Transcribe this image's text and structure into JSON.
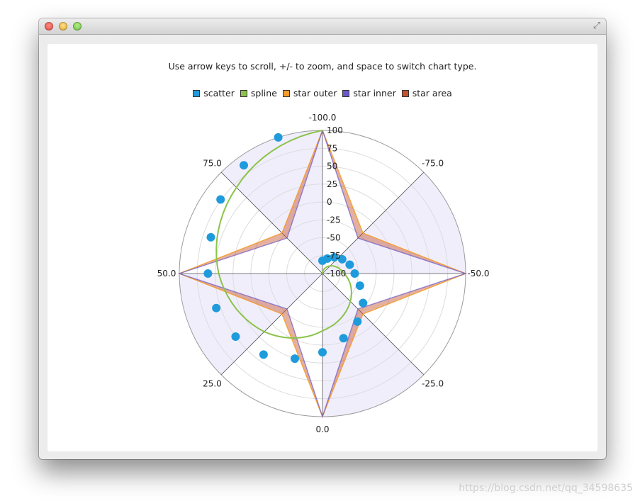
{
  "window": {
    "fullscreen_icon": "fullscreen-arrows-icon"
  },
  "instruction": "Use arrow keys to scroll, +/- to zoom, and space to switch chart type.",
  "legend": [
    {
      "label": "scatter",
      "color": "#1f9bdc"
    },
    {
      "label": "spline",
      "color": "#8bc34a"
    },
    {
      "label": "star outer",
      "color": "#f59c2a"
    },
    {
      "label": "star inner",
      "color": "#6b59c9"
    },
    {
      "label": "star area",
      "color": "#c4532f"
    }
  ],
  "watermark": "https://blog.csdn.net/qq_34598635",
  "chart_data": {
    "type": "polar",
    "angular_axis": {
      "range": [
        -100,
        100
      ],
      "tick_labels": [
        "-100.0",
        "-75.0",
        "-50.0",
        "-25.0",
        "0.0",
        "25.0",
        "50.0",
        "75.0"
      ]
    },
    "radial_axis": {
      "range": [
        -100,
        100
      ],
      "tick_labels": [
        "100",
        "75",
        "50",
        "25",
        "0",
        "-25",
        "-50",
        "-75",
        "-100"
      ]
    },
    "series": [
      {
        "name": "scatter",
        "type": "scatter",
        "color": "#1f9bdc",
        "points": [
          {
            "x": 90,
            "y": 100
          },
          {
            "x": 80,
            "y": 87
          },
          {
            "x": 70,
            "y": 76
          },
          {
            "x": 60,
            "y": 64
          },
          {
            "x": 50,
            "y": 60
          },
          {
            "x": 40,
            "y": 56
          },
          {
            "x": 30,
            "y": 50
          },
          {
            "x": 20,
            "y": 40
          },
          {
            "x": 10,
            "y": 25
          },
          {
            "x": 0,
            "y": 10
          },
          {
            "x": -10,
            "y": -5
          },
          {
            "x": -20,
            "y": -17
          },
          {
            "x": -30,
            "y": -30
          },
          {
            "x": -40,
            "y": -45
          },
          {
            "x": -50,
            "y": -55
          },
          {
            "x": -60,
            "y": -60
          },
          {
            "x": -70,
            "y": -66
          },
          {
            "x": -80,
            "y": -72
          },
          {
            "x": -90,
            "y": -78
          },
          {
            "x": -100,
            "y": -82
          }
        ]
      },
      {
        "name": "spline",
        "type": "spline",
        "color": "#8bc34a",
        "x": [
          100,
          75,
          50,
          25,
          0,
          -25,
          -50,
          -75,
          -100
        ],
        "y": [
          100,
          70,
          45,
          15,
          -20,
          -45,
          -70,
          -85,
          -100
        ]
      },
      {
        "name": "star outer",
        "type": "line",
        "color": "#f59c2a",
        "x": [
          -100,
          -75,
          -50,
          -25,
          0,
          25,
          50,
          75,
          -100
        ],
        "y": [
          100,
          -20,
          100,
          -20,
          100,
          -20,
          100,
          -20,
          100
        ]
      },
      {
        "name": "star inner",
        "type": "line",
        "color": "#6b59c9",
        "x": [
          -100,
          -75,
          -50,
          -25,
          0,
          25,
          50,
          75,
          -100
        ],
        "y": [
          100,
          -30,
          100,
          -30,
          100,
          -30,
          100,
          -30,
          100
        ]
      },
      {
        "name": "star area",
        "type": "area",
        "color": "#c4532f",
        "x": [
          -100,
          -75,
          -50,
          -25,
          0,
          25,
          50,
          75,
          -100
        ],
        "y_upper": [
          100,
          -20,
          100,
          -20,
          100,
          -20,
          100,
          -20,
          100
        ],
        "y_lower": [
          100,
          -30,
          100,
          -30,
          100,
          -30,
          100,
          -30,
          100
        ]
      }
    ],
    "shaded_sectors_color": "#f1eefc",
    "grid": true
  }
}
